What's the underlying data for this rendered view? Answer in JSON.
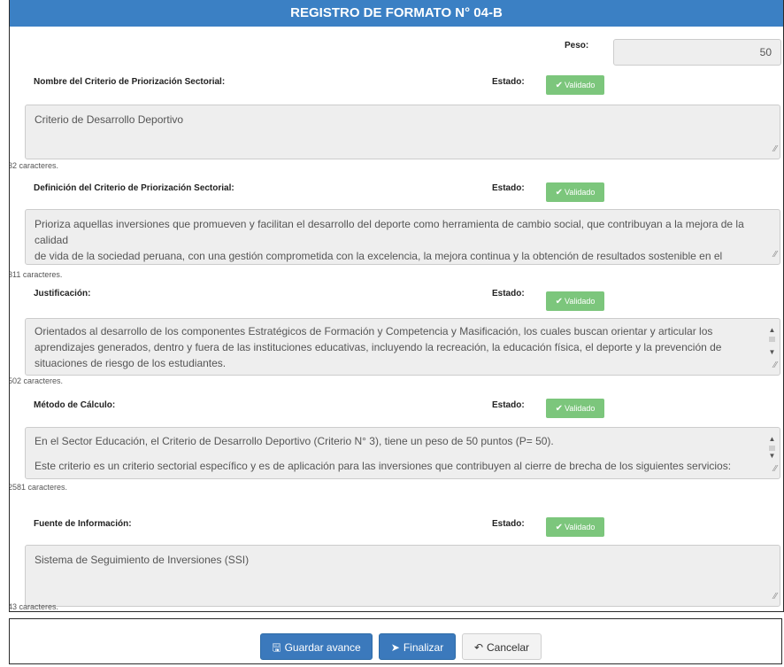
{
  "header": {
    "title": "REGISTRO DE FORMATO N° 04-B"
  },
  "peso": {
    "label": "Peso:",
    "value": "50"
  },
  "estado_label": "Estado:",
  "badge_label": "Validado",
  "sections": [
    {
      "label": "Nombre del Criterio de Priorización Sectorial:",
      "lines": [
        "Criterio de Desarrollo Deportivo"
      ],
      "count": "32 caracteres."
    },
    {
      "label": "Definición del Criterio de Priorización Sectorial:",
      "lines": [
        "Prioriza aquellas inversiones que promueven y facilitan el desarrollo del deporte como herramienta de cambio social, que contribuyan a la mejora de la calidad",
        "de vida de la sociedad peruana, con una gestión comprometida con la excelencia, la mejora continua y la obtención de resultados sostenible en el tiempo."
      ],
      "count": "311 caracteres."
    },
    {
      "label": "Justificación:",
      "lines": [
        "Orientados al desarrollo de los componentes Estratégicos de Formación y Competencia y Masificación, los cuales buscan orientar y articular los",
        "aprendizajes generados, dentro y fuera de las instituciones educativas, incluyendo la recreación, la educación física, el deporte y la prevención de",
        "situaciones de riesgo de los estudiantes."
      ],
      "count": "502 caracteres."
    },
    {
      "label": "Método de Cálculo:",
      "lines": [
        "En el Sector Educación, el Criterio de Desarrollo Deportivo (Criterio N° 3), tiene un peso de 50 puntos (P= 50).",
        "",
        "Este criterio es un criterio sectorial específico y es de aplicación para las inversiones que contribuyen al cierre de brecha de los siguientes servicios:"
      ],
      "count": "2581 caracteres."
    },
    {
      "label": "Fuente de Información:",
      "lines": [
        "Sistema de Seguimiento de Inversiones (SSI)"
      ],
      "count": "43 caracteres."
    }
  ],
  "footer": {
    "save_label": "Guardar avance",
    "finish_label": "Finalizar",
    "cancel_label": "Cancelar"
  }
}
